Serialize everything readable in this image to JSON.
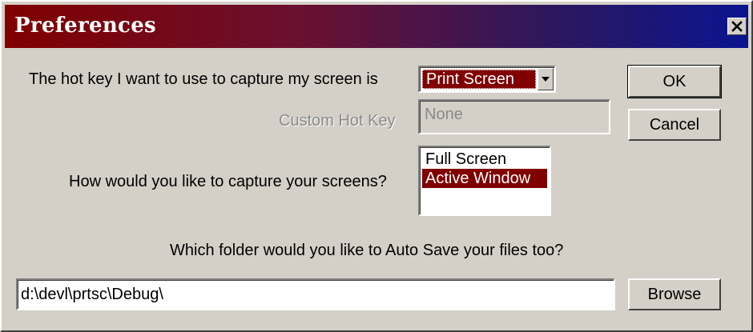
{
  "window": {
    "title": "Preferences"
  },
  "hotkey": {
    "label": "The hot key I want to use to capture my screen is",
    "selected": "Print Screen",
    "custom_label": "Custom Hot Key",
    "custom_value": "None"
  },
  "capture": {
    "label": "How would you like to capture your screens?",
    "options": [
      "Full Screen",
      "Active Window"
    ],
    "selected": "Active Window"
  },
  "autosave": {
    "label": "Which folder would you like to Auto Save your files too?",
    "path": "d:\\devl\\prtsc\\Debug\\"
  },
  "buttons": {
    "ok": "OK",
    "cancel": "Cancel",
    "browse": "Browse"
  },
  "colors": {
    "selection": "#800000",
    "title_gradient_start": "#800000",
    "title_gradient_end": "#0a1490",
    "face": "#d4d0c8"
  },
  "icons": {
    "close": "close-icon",
    "dropdown": "chevron-down-icon"
  }
}
